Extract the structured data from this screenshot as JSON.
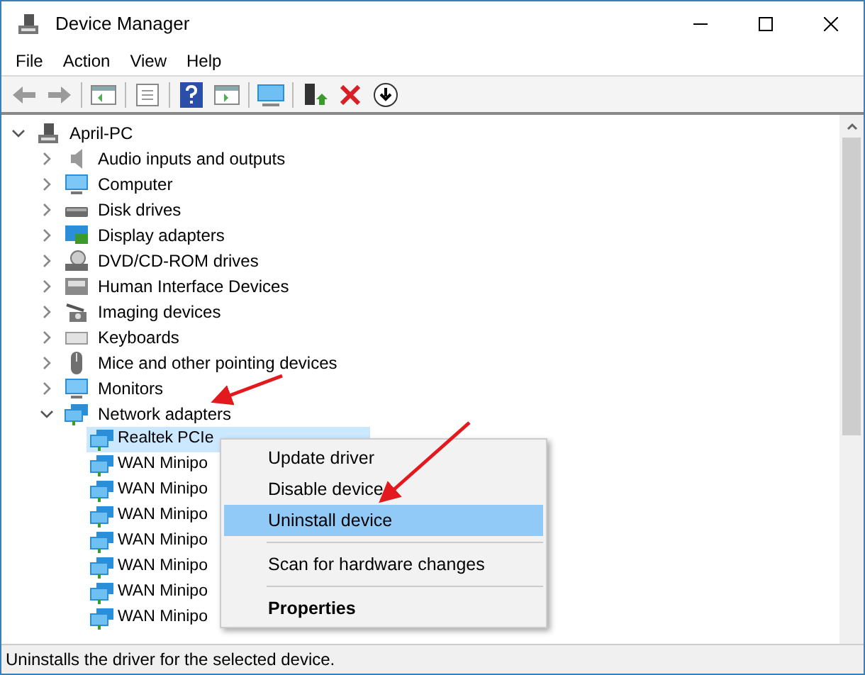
{
  "window": {
    "title": "Device Manager"
  },
  "menu": [
    "File",
    "Action",
    "View",
    "Help"
  ],
  "tree": {
    "label": "April-PC",
    "expanded": true,
    "children": [
      {
        "label": "Audio inputs and outputs",
        "kind": "audio",
        "expanded": false
      },
      {
        "label": "Computer",
        "kind": "computer",
        "expanded": false
      },
      {
        "label": "Disk drives",
        "kind": "disk",
        "expanded": false
      },
      {
        "label": "Display adapters",
        "kind": "display",
        "expanded": false
      },
      {
        "label": "DVD/CD-ROM drives",
        "kind": "dvd",
        "expanded": false
      },
      {
        "label": "Human Interface Devices",
        "kind": "hid",
        "expanded": false
      },
      {
        "label": "Imaging devices",
        "kind": "imaging",
        "expanded": false
      },
      {
        "label": "Keyboards",
        "kind": "keyboard",
        "expanded": false
      },
      {
        "label": "Mice and other pointing devices",
        "kind": "mouse",
        "expanded": false
      },
      {
        "label": "Monitors",
        "kind": "monitor",
        "expanded": false
      },
      {
        "label": "Network adapters",
        "kind": "network",
        "expanded": true,
        "children": [
          {
            "label": "Realtek PCIe",
            "selected": true
          },
          {
            "label": "WAN Minipo",
            "selected": false
          },
          {
            "label": "WAN Minipo",
            "selected": false
          },
          {
            "label": "WAN Minipo",
            "selected": false
          },
          {
            "label": "WAN Minipo",
            "selected": false
          },
          {
            "label": "WAN Minipo",
            "selected": false
          },
          {
            "label": "WAN Minipo",
            "selected": false
          },
          {
            "label": "WAN Minipo",
            "selected": false
          }
        ]
      }
    ]
  },
  "context_menu": [
    {
      "kind": "item",
      "label": "Update driver",
      "selected": false
    },
    {
      "kind": "item",
      "label": "Disable device",
      "selected": false
    },
    {
      "kind": "item",
      "label": "Uninstall device",
      "selected": true
    },
    {
      "kind": "separator"
    },
    {
      "kind": "item",
      "label": "Scan for hardware changes",
      "selected": false
    },
    {
      "kind": "separator"
    },
    {
      "kind": "default",
      "label": "Properties",
      "selected": false
    }
  ],
  "status_bar": "Uninstalls the driver for the selected device."
}
